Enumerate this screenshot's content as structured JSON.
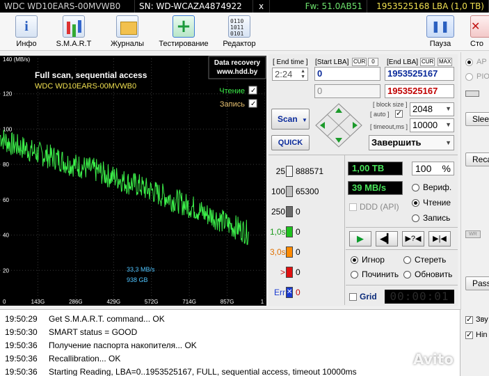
{
  "infobar": {
    "model": "WDC WD10EARS-00MVWB0",
    "serial": "SN: WD-WCAZA4874922",
    "close": "x",
    "firmware": "Fw: 51.0AB51",
    "capacity": "1953525168 LBA (1,0 TB)"
  },
  "toolbar": {
    "info": "Инфо",
    "smart": "S.M.A.R.T",
    "logs": "Журналы",
    "test": "Тестирование",
    "editor": "Редактор",
    "pause": "Пауза",
    "stop": "Сто"
  },
  "graph": {
    "title": "Full scan, sequential access",
    "model": "WDC WD10EARS-00MVWB0",
    "unit": "140 (MB/s)",
    "promo_line1": "Data recovery",
    "promo_line2": "www.hdd.by",
    "read_label": "Чтение",
    "write_label": "Запись",
    "speed_readout": "33,3 MB/s",
    "position_readout": "938 GB",
    "y_ticks": [
      "120",
      "100",
      "80",
      "60",
      "40",
      "20",
      "0"
    ],
    "x_ticks": [
      "143G",
      "286G",
      "429G",
      "572G",
      "714G",
      "857G",
      "1"
    ]
  },
  "chart_data": {
    "type": "line",
    "title": "Full scan, sequential access",
    "ylabel": "MB/s",
    "ylim": [
      0,
      140
    ],
    "x_unit": "GB",
    "xlim": [
      0,
      1000
    ],
    "series": [
      {
        "name": "Чтение",
        "color": "#3cf04a",
        "x": [
          0,
          25,
          50,
          75,
          100,
          125,
          150,
          175,
          200,
          225,
          250,
          275,
          300,
          325,
          350,
          375,
          400,
          425,
          450,
          475,
          500,
          525,
          550,
          575,
          600,
          625,
          650,
          675,
          700,
          725,
          750,
          775,
          800,
          825,
          850,
          875,
          900,
          925,
          938
        ],
        "values": [
          96,
          93,
          91,
          90,
          89,
          87,
          86,
          85,
          84,
          83,
          81,
          80,
          79,
          78,
          77,
          76,
          74,
          73,
          72,
          70,
          69,
          68,
          66,
          65,
          63,
          62,
          60,
          59,
          57,
          56,
          54,
          52,
          51,
          49,
          47,
          45,
          44,
          42,
          41
        ]
      }
    ]
  },
  "ctrl": {
    "end_time_label": "[ End time ]",
    "end_time": "2:24",
    "start_lba_label": "[Start LBA]",
    "cur": "CUR",
    "start_zero": "0",
    "end_lba_label": "[End LBA]",
    "max": "MAX",
    "start_lba": "0",
    "end_lba": "1953525167",
    "cur_lba": "0",
    "end_lba_2": "1953525167",
    "scan_btn": "Scan",
    "quick_btn": "QUICK",
    "block_size_label": "[ block size ]",
    "auto_label": "[ auto ]",
    "block_size": "2048",
    "timeout_label": "[ timeout,ms ]",
    "timeout": "10000",
    "finish": "Завершить"
  },
  "histogram": [
    {
      "label": "25",
      "value": "888571",
      "color": "#f4f4f4"
    },
    {
      "label": "100",
      "value": "65300",
      "color": "#bdbdbd"
    },
    {
      "label": "250",
      "value": "0",
      "color": "#6b6b6b"
    },
    {
      "label": "1,0s",
      "value": "0",
      "color": "#1ec21e"
    },
    {
      "label": "3,0s",
      "value": "0",
      "color": "#ff8a00"
    },
    {
      "label": ">",
      "value": "0",
      "color": "#e01010"
    },
    {
      "label": "Err",
      "value": "0",
      "color": "#1a3ad0"
    }
  ],
  "status": {
    "capacity": "1,00 TB",
    "percent": "100",
    "percent_unit": "%",
    "speed": "39 MB/s",
    "verify": "Вериф.",
    "read": "Чтение",
    "write": "Запись",
    "ddd": "DDD (API)",
    "ignore": "Игнор",
    "erase": "Стереть",
    "remap": "Починить",
    "refresh": "Обновить",
    "grid": "Grid",
    "timer": "00:00:01"
  },
  "farright": {
    "api": "AP",
    "pio": "PIO",
    "sleep": "Slee",
    "recal": "Reca",
    "passp": "Pass",
    "wr": "WR"
  },
  "log": [
    {
      "time": "19:50:29",
      "text": "Get S.M.A.R.T. command... OK"
    },
    {
      "time": "19:50:30",
      "text": "SMART status = GOOD"
    },
    {
      "time": "19:50:36",
      "text": "Получение паспорта накопителя... OK"
    },
    {
      "time": "19:50:36",
      "text": "Recallibration... OK"
    },
    {
      "time": "19:50:36",
      "text": "Starting Reading, LBA=0..1953525167, FULL, sequential access, timeout 10000ms"
    }
  ],
  "logright": {
    "sound": "Зву",
    "hints": "Hin"
  },
  "watermark": "Avito"
}
